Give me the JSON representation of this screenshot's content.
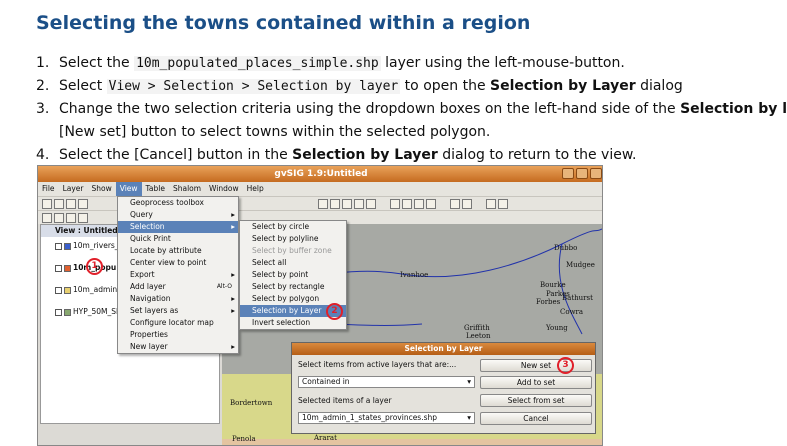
{
  "title": "Selecting the towns contained within a region",
  "steps": [
    {
      "num": "1.",
      "a": "Select the ",
      "code": "10m_populated_places_simple.shp",
      "b": " layer using the left-mouse-button."
    },
    {
      "num": "2.",
      "a": "Select ",
      "code": "View > Selection > Selection by layer",
      "b": " to open the ",
      "bold": "Selection by Layer",
      "c": " dialog"
    },
    {
      "num": "3.",
      "a": "Change the two selection criteria using the dropdown boxes on the left-hand side of the ",
      "bold": "Selection by l",
      "line2": "[New set] button to select towns within the selected polygon."
    },
    {
      "num": "4.",
      "a": "Select the [Cancel] button in the ",
      "bold": "Selection by Layer",
      "c": " dialog to return to the view."
    }
  ],
  "screenshot": {
    "window_title": "gvSIG 1.9:Untitled",
    "menubar": [
      "File",
      "Layer",
      "Show",
      "View",
      "Table",
      "Shalom",
      "Window",
      "Help"
    ],
    "active_menu": "View",
    "view_header": "View : Untitled",
    "layers": [
      "10m_rivers_",
      "10m_popu",
      "10m_admin",
      "HYP_50M_SR"
    ],
    "view_menu": [
      {
        "label": "Geoprocess toolbox",
        "arrow": ""
      },
      {
        "label": "Query",
        "arrow": "▸"
      },
      {
        "label": "Selection",
        "arrow": "▸"
      },
      {
        "label": "Quick Print",
        "arrow": ""
      },
      {
        "label": "Locate by attribute",
        "arrow": ""
      },
      {
        "label": "Center view to point",
        "arrow": ""
      },
      {
        "label": "Export",
        "arrow": "▸"
      },
      {
        "label": "Add layer",
        "shortcut": "Alt-O"
      },
      {
        "label": "Navigation",
        "arrow": "▸"
      },
      {
        "label": "Set layers as",
        "arrow": "▸"
      },
      {
        "label": "Configure locator map",
        "arrow": ""
      },
      {
        "label": "Properties",
        "arrow": ""
      },
      {
        "label": "New layer",
        "arrow": "▸"
      }
    ],
    "selection_menu": [
      "Select by circle",
      "Select by polyline",
      "Select by buffer zone",
      "Select all",
      "Select by point",
      "Select by rectangle",
      "Select by polygon",
      "Selection by Layer",
      "Invert selection"
    ],
    "towns": [
      "Ivanhoe",
      "Bourke",
      "Dubbo",
      "Mudgee",
      "Parkes",
      "Forbes",
      "Bathurst",
      "Cowra",
      "Young",
      "Griffith",
      "Leeton",
      "Bordertown",
      "Penola",
      "Ararat"
    ],
    "dialog": {
      "title": "Selection by Layer",
      "label1": "Select items from active layers that are:...",
      "select1": "Contained in",
      "label2": "Selected items of a layer",
      "select2": "10m_admin_1_states_provinces.shp",
      "buttons": [
        "New set",
        "Add to set",
        "Select from set",
        "Cancel"
      ]
    },
    "badges": [
      "1",
      "2",
      "3"
    ]
  }
}
